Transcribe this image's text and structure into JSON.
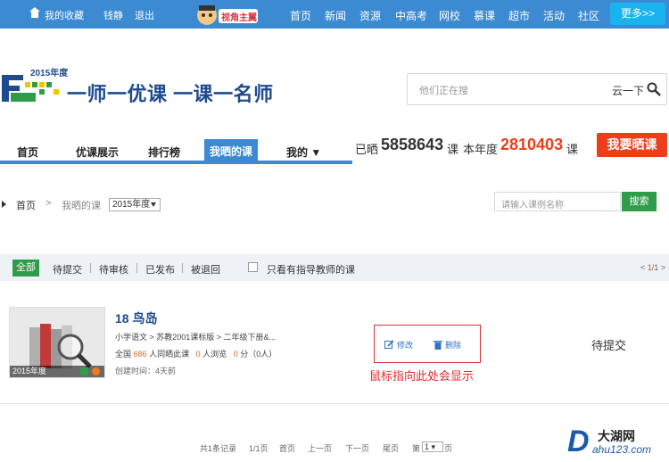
{
  "topbar": {
    "favorites": "我的收藏",
    "user": "钱静",
    "logout": "退出",
    "nav": [
      "首页",
      "新闻",
      "资源",
      "中高考",
      "网校",
      "慕课",
      "超市",
      "活动",
      "社区"
    ],
    "more": "更多>>",
    "mascot_text": "视角主翼"
  },
  "header": {
    "logo_year": "2015年度",
    "slogan": "一师一优课  一课一名师",
    "search_placeholder": "他们正在搜",
    "search_button": "云一下"
  },
  "mainnav": {
    "items": [
      "首页",
      "优课展示",
      "排行榜",
      "我晒的课",
      "我的 ▼"
    ],
    "stats": {
      "shared_label": "已晒",
      "shared_count": "5858643",
      "unit1": "课",
      "year_label": "本年度",
      "year_count": "2810403",
      "unit2": "课"
    },
    "share_button": "我要晒课"
  },
  "breadcrumb": {
    "home": "首页",
    "sep": ">",
    "current": "我晒的课",
    "year_select": "2015年度",
    "course_search_placeholder": "请输入课例名称",
    "search_button": "搜索"
  },
  "filters": {
    "all": "全部",
    "items": [
      "待提交",
      "待审核",
      "已发布",
      "被退回"
    ],
    "checkbox_label": "只看有指导教师的课",
    "pager_prev": "<",
    "pager_page": "1",
    "pager_total": "/1",
    "pager_next": ">"
  },
  "course": {
    "thumb_year": "2015年度",
    "title": "18 鸟岛",
    "meta": "小学语文  >  苏教2001课标版  >  二年级下册&...",
    "views_prefix": "全国",
    "views_count": "686",
    "views_suffix": "人同晒此课",
    "browse_count": "0",
    "browse_label": "人浏览",
    "score": "0",
    "score_label": "分（0人）",
    "created": "创建时间：4天前",
    "edit": "修改",
    "delete": "删除",
    "hint": "鼠标指向此处会显示",
    "status": "待提交"
  },
  "pagination": {
    "records": "共1条记录",
    "pages": "1/1页",
    "first": "首页",
    "prev": "上一页",
    "next": "下一页",
    "last": "尾页",
    "goto_prefix": "第",
    "goto_value": "1",
    "goto_suffix": "页"
  },
  "watermark": {
    "letter": "D",
    "name": "大湖网",
    "url": "ahu123.com"
  },
  "colors": {
    "primary_blue": "#3b8ad2",
    "accent_red": "#ec3e1b",
    "green": "#2e9c48"
  }
}
